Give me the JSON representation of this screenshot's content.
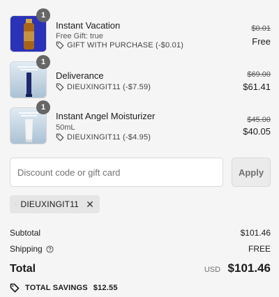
{
  "items": [
    {
      "name": "Instant Vacation",
      "quantity": "1",
      "detail": "Free Gift: true",
      "discount": "GIFT WITH PURCHASE (-$0.01)",
      "original_price": "$0.01",
      "final_price": "Free",
      "thumb_icon": "amber-bottle-product-image",
      "thumb_bg": "#2a32b8"
    },
    {
      "name": "Deliverance",
      "quantity": "1",
      "detail": "",
      "discount": "DIEUXINGIT11 (-$7.59)",
      "original_price": "$69.00",
      "final_price": "$61.41",
      "thumb_icon": "navy-tube-product-image",
      "thumb_bg": "#b9cddc"
    },
    {
      "name": "Instant Angel Moisturizer",
      "quantity": "1",
      "detail": "50mL",
      "discount": "DIEUXINGIT11 (-$4.95)",
      "original_price": "$45.00",
      "final_price": "$40.05",
      "thumb_icon": "white-tube-product-image",
      "thumb_bg": "#b9cddc"
    }
  ],
  "discount_code": {
    "placeholder": "Discount code or gift card",
    "value": "",
    "apply_label": "Apply"
  },
  "applied_code": {
    "label": "DIEUXINGIT11",
    "remove": "✕"
  },
  "summary": {
    "subtotal_label": "Subtotal",
    "subtotal_value": "$101.46",
    "shipping_label": "Shipping",
    "shipping_value": "FREE",
    "total_label": "Total",
    "currency": "USD",
    "total_value": "$101.46",
    "savings_label": "TOTAL SAVINGS",
    "savings_value": "$12.55"
  },
  "colors": {
    "background": "#f5f5f5",
    "quantity_badge": "#666666",
    "apply_button_bg": "#ebebeb",
    "chip_bg": "#e5e5e5"
  }
}
